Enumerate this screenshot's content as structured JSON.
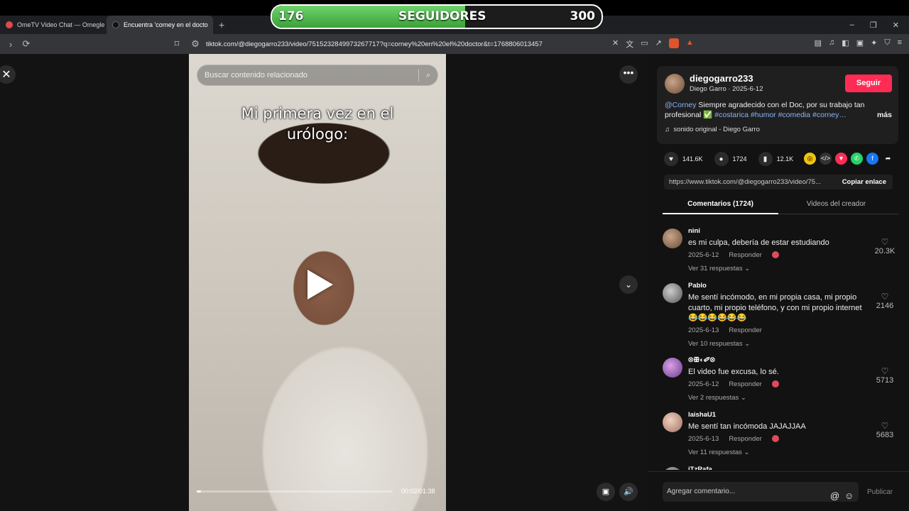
{
  "followers_overlay": {
    "current": "176",
    "label": "SEGUIDORES",
    "goal": "300",
    "progress": 0.587
  },
  "browser": {
    "tabs": [
      {
        "label": "OmeTV Video Chat — Omegle R",
        "active": false
      },
      {
        "label": "Encuentra 'corney en el docto",
        "active": true
      }
    ],
    "url": "tiktok.com/@diegogarro233/video/7515232849973267717?q=corney%20en%20el%20doctor&t=1768806013457"
  },
  "video": {
    "search_placeholder": "Buscar contenido relacionado",
    "caption_line1": "Mi primera vez en el",
    "caption_line2": "urólogo:",
    "time": "00:02/01:38",
    "progress": 0.02
  },
  "post": {
    "username": "diegogarro233",
    "subline": "Diego Garro · 2025-6-12",
    "follow_label": "Seguir",
    "desc_mention": "@Corney",
    "desc_text": " Siempre agradecido con el Doc, por su trabajo tan profesional ✅ ",
    "desc_tags": "#costarica #humor #comedia #corney…",
    "desc_more": "más",
    "sound": "sonido original - Diego Garro",
    "likes": "141.6K",
    "comments_count": "1724",
    "saves": "12.1K",
    "link": "https://www.tiktok.com/@diegogarro233/video/75...",
    "copy_label": "Copiar enlace"
  },
  "panel_tabs": {
    "comments": "Comentarios (1724)",
    "creator_videos": "Videos del creador"
  },
  "comments": [
    {
      "name": "nini",
      "text": "es mi culpa, debería de estar estudiando",
      "date": "2025-6-12",
      "reply": "Responder",
      "replies": "Ver 31 respuestas",
      "likes": "20.3K"
    },
    {
      "name": "Pablo",
      "text": "Me sentí incómodo, en mi propia casa, mi propio cuarto, mi propio teléfono, y con mi propio internet 😂😂😂😂😂😂",
      "date": "2025-6-13",
      "reply": "Responder",
      "replies": "Ver 10 respuestas",
      "likes": "2146"
    },
    {
      "name": "⊗ꕥ◐✐⊗",
      "text": "El video fue excusa, lo sé.",
      "date": "2025-6-12",
      "reply": "Responder",
      "replies": "Ver 2 respuestas",
      "likes": "5713"
    },
    {
      "name": "laishaU1",
      "text": "Me sentí tan incómoda JAJAJJAA",
      "date": "2025-6-13",
      "reply": "Responder",
      "replies": "Ver 11 respuestas",
      "likes": "5683"
    },
    {
      "name": "iTzRafa",
      "text": "",
      "date": "",
      "reply": "",
      "replies": "",
      "likes": ""
    }
  ],
  "composer": {
    "placeholder": "Agregar comentario...",
    "publish": "Publicar"
  },
  "colors": {
    "accent": "#fe2c55",
    "progress_green": "#4fb84c",
    "link_blue": "#8ab4f8"
  }
}
